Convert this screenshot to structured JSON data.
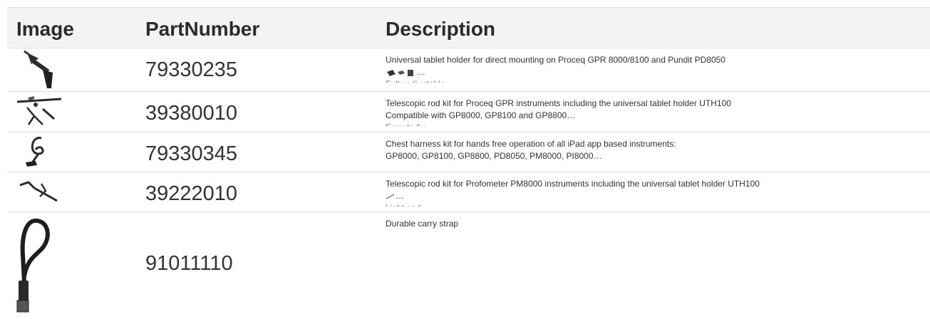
{
  "table": {
    "headers": {
      "image": "Image",
      "part_number": "PartNumber",
      "description": "Description"
    },
    "rows": [
      {
        "image_icon": "tablet-holder-icon",
        "part_number": "79330235",
        "desc_line1": "Universal tablet holder for direct mounting on Proceq GPR 8000/8100 and Pundit PD8050",
        "desc_line2": "…",
        "desc_cut": "Fully adjustable …"
      },
      {
        "image_icon": "telescopic-rod-kit-icon",
        "part_number": "39380010",
        "desc_line1": "Telescopic rod kit for Proceq GPR instruments including the universal tablet holder UTH100",
        "desc_line2": "Compatible with GP8000, GP8100 and GP8800…",
        "desc_cut": "Easy to fix …"
      },
      {
        "image_icon": "chest-harness-icon",
        "part_number": "79330345",
        "desc_line1": "Chest harness kit for hands free operation of all iPad app based instruments:",
        "desc_line2": "GP8000, GP8100, GP8800, PD8050, PM8000, PI8000…"
      },
      {
        "image_icon": "telescopic-rod-profometer-icon",
        "part_number": "39222010",
        "desc_line1": "Telescopic rod kit for Profometer PM8000 instruments including the universal tablet holder UTH100",
        "desc_line2": "…",
        "desc_cut": "Light and …"
      },
      {
        "image_icon": "carry-strap-icon",
        "part_number": "91011110",
        "desc_line1": "Durable carry strap"
      }
    ]
  }
}
